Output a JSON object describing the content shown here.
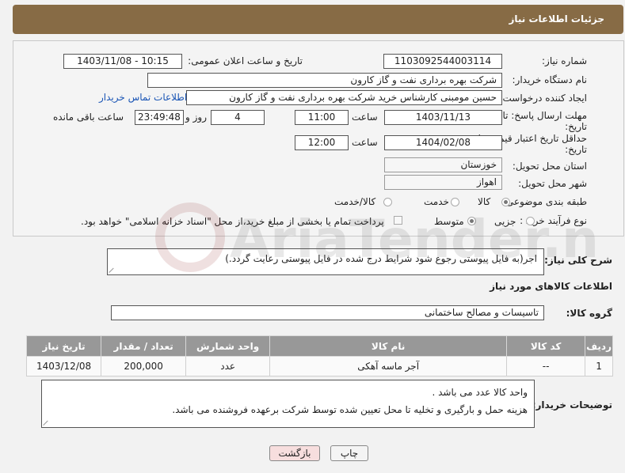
{
  "header": {
    "title": "جزئیات اطلاعات نیاز"
  },
  "fields": {
    "need_number_label": "شماره نیاز:",
    "need_number": "1103092544003114",
    "announce_label": "تاریخ و ساعت اعلان عمومی:",
    "announce_value": "1403/11/08 - 10:15",
    "buyer_org_label": "نام دستگاه خریدار:",
    "buyer_org": "شرکت بهره برداری نفت و گاز کارون",
    "requester_label": "ایجاد کننده درخواست:",
    "requester": "حسین مومبنی کارشناس خرید شرکت بهره برداری نفت و گاز کارون",
    "contact_link": "اطلاعات تماس خریدار",
    "deadline_label": "مهلت ارسال پاسخ: تا",
    "deadline_label2": "تاریخ:",
    "deadline_date": "1403/11/13",
    "time_label": "ساعت",
    "deadline_time": "11:00",
    "days_value": "4",
    "days_label": "روز و",
    "remaining_time": "23:49:48",
    "remaining_label": "ساعت باقی مانده",
    "validity_label": "حداقل تاریخ اعتبار قیمت: تا",
    "validity_label2": "تاریخ:",
    "validity_date": "1404/02/08",
    "validity_time": "12:00",
    "province_label": "استان محل تحویل:",
    "province": "خوزستان",
    "city_label": "شهر محل تحویل:",
    "city": "اهواز",
    "category_label": "طبقه بندی موضوعی:",
    "cat_goods": "کالا",
    "cat_service": "خدمت",
    "cat_goods_service": "کالا/خدمت",
    "process_label": "نوع فرآیند خرید :",
    "proc_partial": "جزیی",
    "proc_medium": "متوسط",
    "payment_note": "پرداخت تمام یا بخشی از مبلغ خرید،از محل \"اسناد خزانه اسلامی\" خواهد بود."
  },
  "description": {
    "label": "شرح کلی نیاز:",
    "text": "اجر(به فایل پیوستی رجوع شود شرایط درج شده در فایل پیوستی رعایت گردد.)"
  },
  "goods_section_title": "اطلاعات کالاهای مورد نیاز",
  "goods_group": {
    "label": "گروه کالا:",
    "value": "تاسیسات و مصالح ساختمانی"
  },
  "table": {
    "headers": [
      "ردیف",
      "کد کالا",
      "نام کالا",
      "واحد شمارش",
      "تعداد / مقدار",
      "تاریخ نیاز"
    ],
    "rows": [
      {
        "row": "1",
        "code": "--",
        "name": "آجر ماسه آهکی",
        "unit": "عدد",
        "qty": "200,000",
        "date": "1403/12/08"
      }
    ]
  },
  "buyer_notes": {
    "label": "توضیحات خریدار:",
    "line1": "واحد کالا عدد می باشد .",
    "line2": "هزینه حمل و بارگیری و تخلیه تا محل تعیین شده توسط شرکت برعهده فروشنده می باشد."
  },
  "buttons": {
    "print": "چاپ",
    "back": "بازگشت"
  },
  "watermark_text": "AriaTender.net",
  "colors": {
    "header_bg": "#876b45",
    "table_header_bg": "#989898",
    "link": "#1a55b5",
    "back_button_bg": "#f7dede"
  }
}
